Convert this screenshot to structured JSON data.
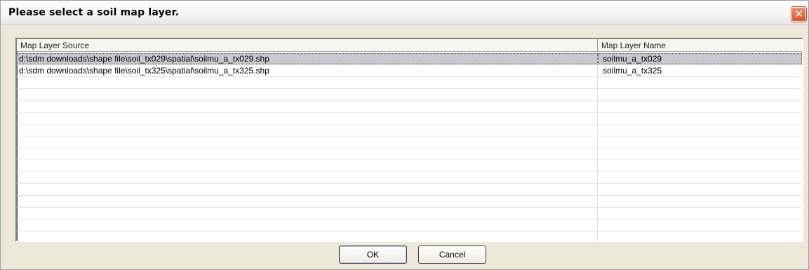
{
  "window": {
    "title": "Please select a soil map layer.",
    "close_glyph": "✕"
  },
  "table": {
    "columns": [
      "Map Layer Source",
      "Map Layer Name"
    ],
    "rows": [
      {
        "source": "d:\\sdm downloads\\shape file\\soil_tx029\\spatial\\soilmu_a_tx029.shp",
        "name": "soilmu_a_tx029",
        "selected": true
      },
      {
        "source": "d:\\sdm downloads\\shape file\\soil_tx325\\spatial\\soilmu_a_tx325.shp",
        "name": "soilmu_a_tx325",
        "selected": false
      }
    ]
  },
  "buttons": {
    "ok_label": "OK",
    "cancel_label": "Cancel"
  },
  "colors": {
    "selection": "#c8c8d0",
    "close_button": "#d8542c",
    "dialog_background": "#ece9d8"
  }
}
